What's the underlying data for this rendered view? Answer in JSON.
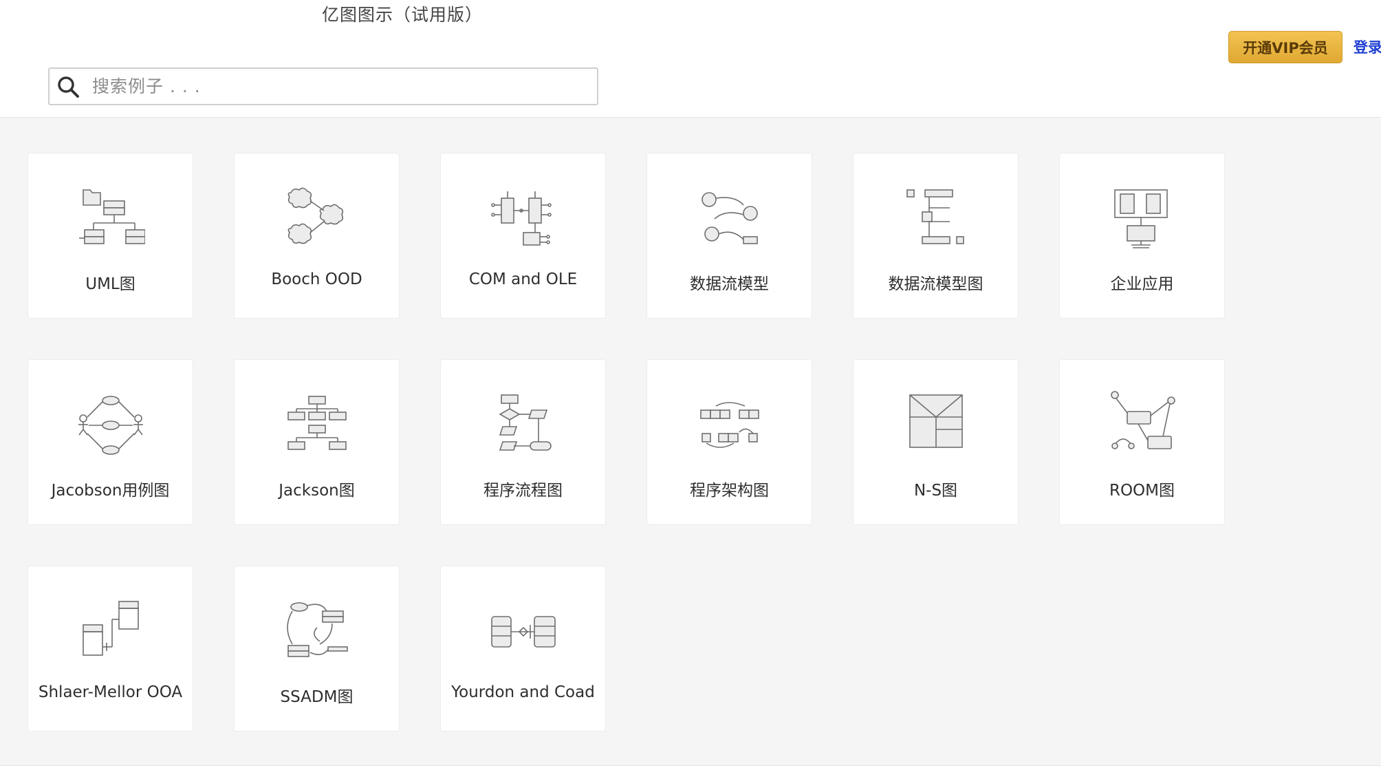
{
  "app": {
    "title": "亿图图示（试用版）"
  },
  "header": {
    "vip_button": "开通VIP会员",
    "login_link": "登录",
    "accent_color": "#e8b23f",
    "link_color": "#1f3fd1"
  },
  "search": {
    "placeholder": "搜索例子 . . ."
  },
  "templates": [
    {
      "label": "UML图",
      "icon": "uml-icon"
    },
    {
      "label": "Booch OOD",
      "icon": "booch-icon"
    },
    {
      "label": "COM and OLE",
      "icon": "com-ole-icon"
    },
    {
      "label": "数据流模型",
      "icon": "data-flow-model-icon"
    },
    {
      "label": "数据流模型图",
      "icon": "data-flow-diagram-icon"
    },
    {
      "label": "企业应用",
      "icon": "enterprise-app-icon"
    },
    {
      "label": "Jacobson用例图",
      "icon": "jacobson-icon"
    },
    {
      "label": "Jackson图",
      "icon": "jackson-icon"
    },
    {
      "label": "程序流程图",
      "icon": "program-flowchart-icon"
    },
    {
      "label": "程序架构图",
      "icon": "program-structure-icon"
    },
    {
      "label": "N-S图",
      "icon": "ns-diagram-icon"
    },
    {
      "label": "ROOM图",
      "icon": "room-icon"
    },
    {
      "label": "Shlaer-Mellor OOA",
      "icon": "shlaer-mellor-icon"
    },
    {
      "label": "SSADM图",
      "icon": "ssadm-icon"
    },
    {
      "label": "Yourdon and Coad",
      "icon": "yourdon-coad-icon"
    }
  ]
}
